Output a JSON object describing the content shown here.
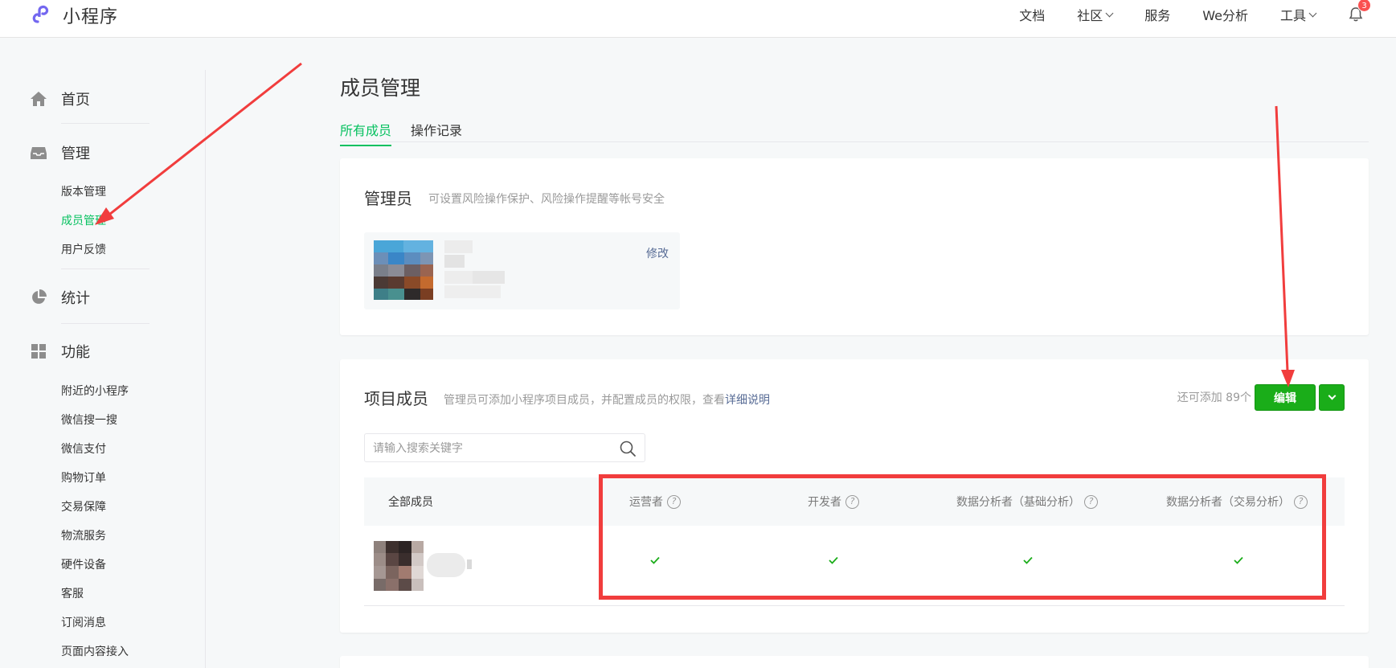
{
  "header": {
    "logo_text": "小程序",
    "nav": [
      "文档",
      "社区",
      "服务",
      "We分析",
      "工具"
    ],
    "notification_count": "3"
  },
  "sidebar": {
    "groups": [
      {
        "label": "首页",
        "icon": "home-icon"
      },
      {
        "label": "管理",
        "icon": "inbox-icon",
        "items": [
          "版本管理",
          "成员管理",
          "用户反馈"
        ]
      },
      {
        "label": "统计",
        "icon": "pie-chart-icon"
      },
      {
        "label": "功能",
        "icon": "grid-icon",
        "items": [
          "附近的小程序",
          "微信搜一搜",
          "微信支付",
          "购物订单",
          "交易保障",
          "物流服务",
          "硬件设备",
          "客服",
          "订阅消息",
          "页面内容接入"
        ]
      }
    ],
    "active_item": "成员管理"
  },
  "main": {
    "title": "成员管理",
    "tabs": [
      "所有成员",
      "操作记录"
    ],
    "admin": {
      "title": "管理员",
      "desc": "可设置风险操作保护、风险操作提醒等帐号安全",
      "edit_label": "修改"
    },
    "project": {
      "title": "项目成员",
      "desc": "管理员可添加小程序项目成员，并配置成员的权限，查看",
      "desc_link": "详细说明",
      "remaining": "还可添加 89个",
      "edit_button": "编辑",
      "search_placeholder": "请输入搜索关键字",
      "columns": [
        "全部成员",
        "运营者",
        "开发者",
        "数据分析者（基础分析）",
        "数据分析者（交易分析）"
      ],
      "rows": [
        {
          "permissions": [
            true,
            true,
            true,
            true
          ]
        }
      ]
    }
  },
  "colors": {
    "accent": "#07c160",
    "button": "#1aad19",
    "link": "#576b95",
    "annotation": "#f13d3d"
  }
}
